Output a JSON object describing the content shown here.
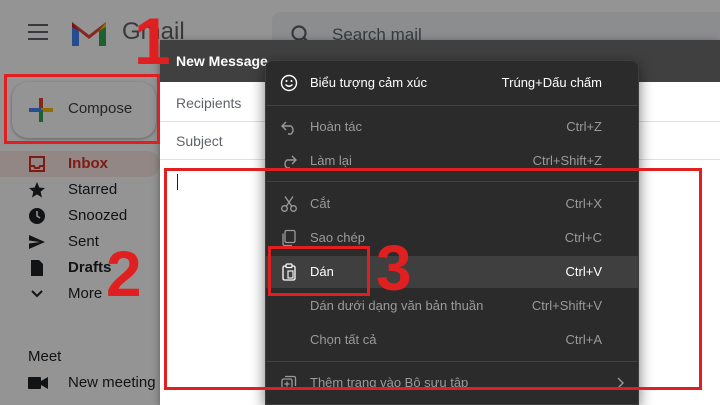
{
  "gmail": {
    "logo_text": "Gmail",
    "search_placeholder": "Search mail",
    "compose_label": "Compose",
    "nav": [
      {
        "label": "Inbox",
        "icon": "inbox-icon"
      },
      {
        "label": "Starred",
        "icon": "star-icon"
      },
      {
        "label": "Snoozed",
        "icon": "clock-icon"
      },
      {
        "label": "Sent",
        "icon": "send-icon"
      },
      {
        "label": "Drafts",
        "icon": "draft-icon"
      },
      {
        "label": "More",
        "icon": "chevron-down-icon"
      }
    ],
    "meet_title": "Meet",
    "meet_new": "New meeting"
  },
  "compose_window": {
    "title": "New Message",
    "recipients_label": "Recipients",
    "subject_label": "Subject"
  },
  "context_menu": {
    "items": [
      {
        "label": "Biểu tượng cảm xúc",
        "shortcut": "Trúng+Dấu chấm",
        "icon": "emoji-icon",
        "enabled": true
      },
      {
        "label": "Hoàn tác",
        "shortcut": "Ctrl+Z",
        "icon": "undo-icon",
        "enabled": false
      },
      {
        "label": "Làm lại",
        "shortcut": "Ctrl+Shift+Z",
        "icon": "redo-icon",
        "enabled": false
      },
      {
        "label": "Cắt",
        "shortcut": "Ctrl+X",
        "icon": "scissors-icon",
        "enabled": false
      },
      {
        "label": "Sao chép",
        "shortcut": "Ctrl+C",
        "icon": "copy-icon",
        "enabled": false
      },
      {
        "label": "Dán",
        "shortcut": "Ctrl+V",
        "icon": "clipboard-icon",
        "enabled": true
      },
      {
        "label": "Dán dưới dạng văn bản thuần",
        "shortcut": "Ctrl+Shift+V",
        "icon": "",
        "enabled": false
      },
      {
        "label": "Chọn tất cả",
        "shortcut": "Ctrl+A",
        "icon": "",
        "enabled": false
      },
      {
        "label": "Thêm trang vào Bộ sưu tập",
        "shortcut": "",
        "icon": "collection-add-icon",
        "enabled": false
      }
    ]
  },
  "annotations": {
    "step1": "1",
    "step2": "2",
    "step3": "3",
    "color": "#e02020"
  }
}
